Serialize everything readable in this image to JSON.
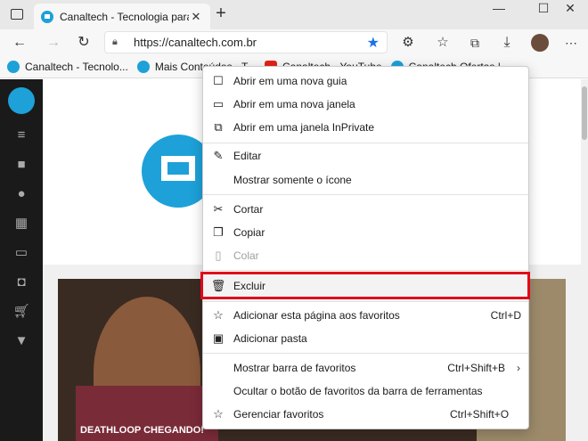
{
  "browser": {
    "tab": {
      "title": "Canaltech - Tecnologia para quem",
      "close": "✕"
    },
    "new_tab": "+",
    "window_controls": {
      "minimize": "—",
      "maximize": "☐",
      "close": "✕"
    }
  },
  "address_bar": {
    "url": "https://canaltech.com.br",
    "back": "←",
    "forward": "→",
    "refresh": "↻"
  },
  "bookmarks": [
    {
      "label": "Canaltech - Tecnolo...",
      "icon": "canaltech-icon",
      "color": "#1da1d8"
    },
    {
      "label": "Mais Conteúdos - T...",
      "icon": "canaltech-icon",
      "color": "#1da1d8"
    },
    {
      "label": "Canaltech - YouTube",
      "icon": "youtube-icon",
      "color": "#e62117"
    },
    {
      "label": "Canaltech Ofertas |",
      "icon": "canaltech-icon",
      "color": "#1da1d8"
    }
  ],
  "article": {
    "caption": "DEATHLOOP CHEGANDO!"
  },
  "menu": {
    "items": [
      {
        "label": "Abrir em uma nova guia",
        "icon": "new-tab-icon",
        "shortcut": ""
      },
      {
        "label": "Abrir em uma nova janela",
        "icon": "new-window-icon",
        "shortcut": ""
      },
      {
        "label": "Abrir em uma janela InPrivate",
        "icon": "inprivate-icon",
        "shortcut": ""
      },
      {
        "label": "Editar",
        "icon": "pencil-icon",
        "shortcut": ""
      },
      {
        "label": "Mostrar somente o ícone",
        "icon": "",
        "shortcut": ""
      },
      {
        "label": "Cortar",
        "icon": "scissors-icon",
        "shortcut": ""
      },
      {
        "label": "Copiar",
        "icon": "copy-icon",
        "shortcut": ""
      },
      {
        "label": "Colar",
        "icon": "paste-icon",
        "shortcut": "",
        "disabled": true
      },
      {
        "label": "Excluir",
        "icon": "trash-icon",
        "shortcut": ""
      },
      {
        "label": "Adicionar esta página aos favoritos",
        "icon": "add-favorite-icon",
        "shortcut": "Ctrl+D"
      },
      {
        "label": "Adicionar pasta",
        "icon": "add-folder-icon",
        "shortcut": ""
      },
      {
        "label": "Mostrar barra de favoritos",
        "icon": "",
        "shortcut": "Ctrl+Shift+B",
        "submenu": true
      },
      {
        "label": "Ocultar o botão de favoritos da barra de ferramentas",
        "icon": "",
        "shortcut": ""
      },
      {
        "label": "Gerenciar favoritos",
        "icon": "manage-favorites-icon",
        "shortcut": "Ctrl+Shift+O"
      }
    ],
    "highlight_color": "#e0081b"
  }
}
